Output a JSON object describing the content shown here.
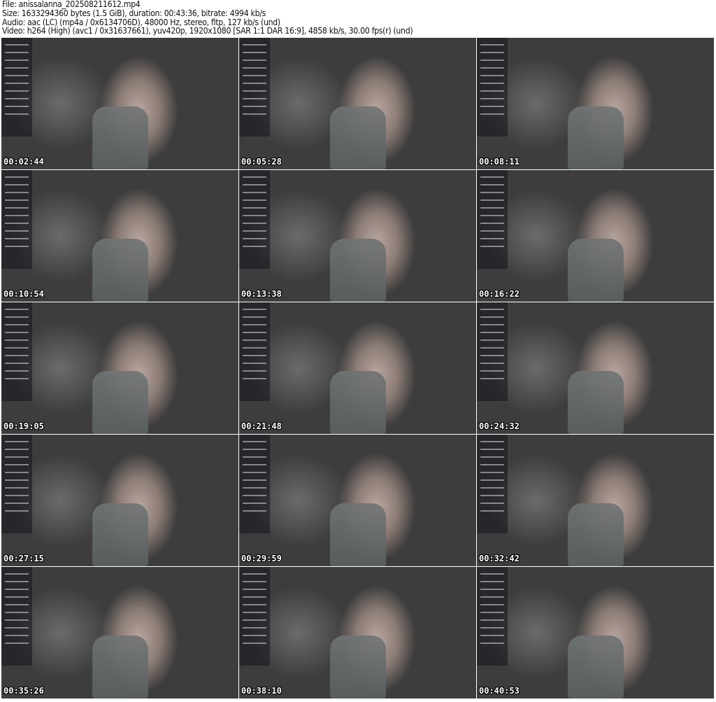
{
  "header": {
    "file": "File: anissalanna_202508211612.mp4",
    "size": "Size: 1633294360 bytes (1.5 GiB), duration: 00:43:36, bitrate: 4994 kb/s",
    "audio": "Audio: aac (LC) (mp4a / 0x6134706D), 48000 Hz, stereo, fltp, 127 kb/s (und)",
    "video": "Video: h264 (High) (avc1 / 0x31637661), yuv420p, 1920x1080 [SAR 1:1 DAR 16:9], 4858 kb/s, 30.00 fps(r) (und)"
  },
  "thumbnails": [
    "00:02:44",
    "00:05:28",
    "00:08:11",
    "00:10:54",
    "00:13:38",
    "00:16:22",
    "00:19:05",
    "00:21:48",
    "00:24:32",
    "00:27:15",
    "00:29:59",
    "00:32:42",
    "00:35:26",
    "00:38:10",
    "00:40:53"
  ]
}
